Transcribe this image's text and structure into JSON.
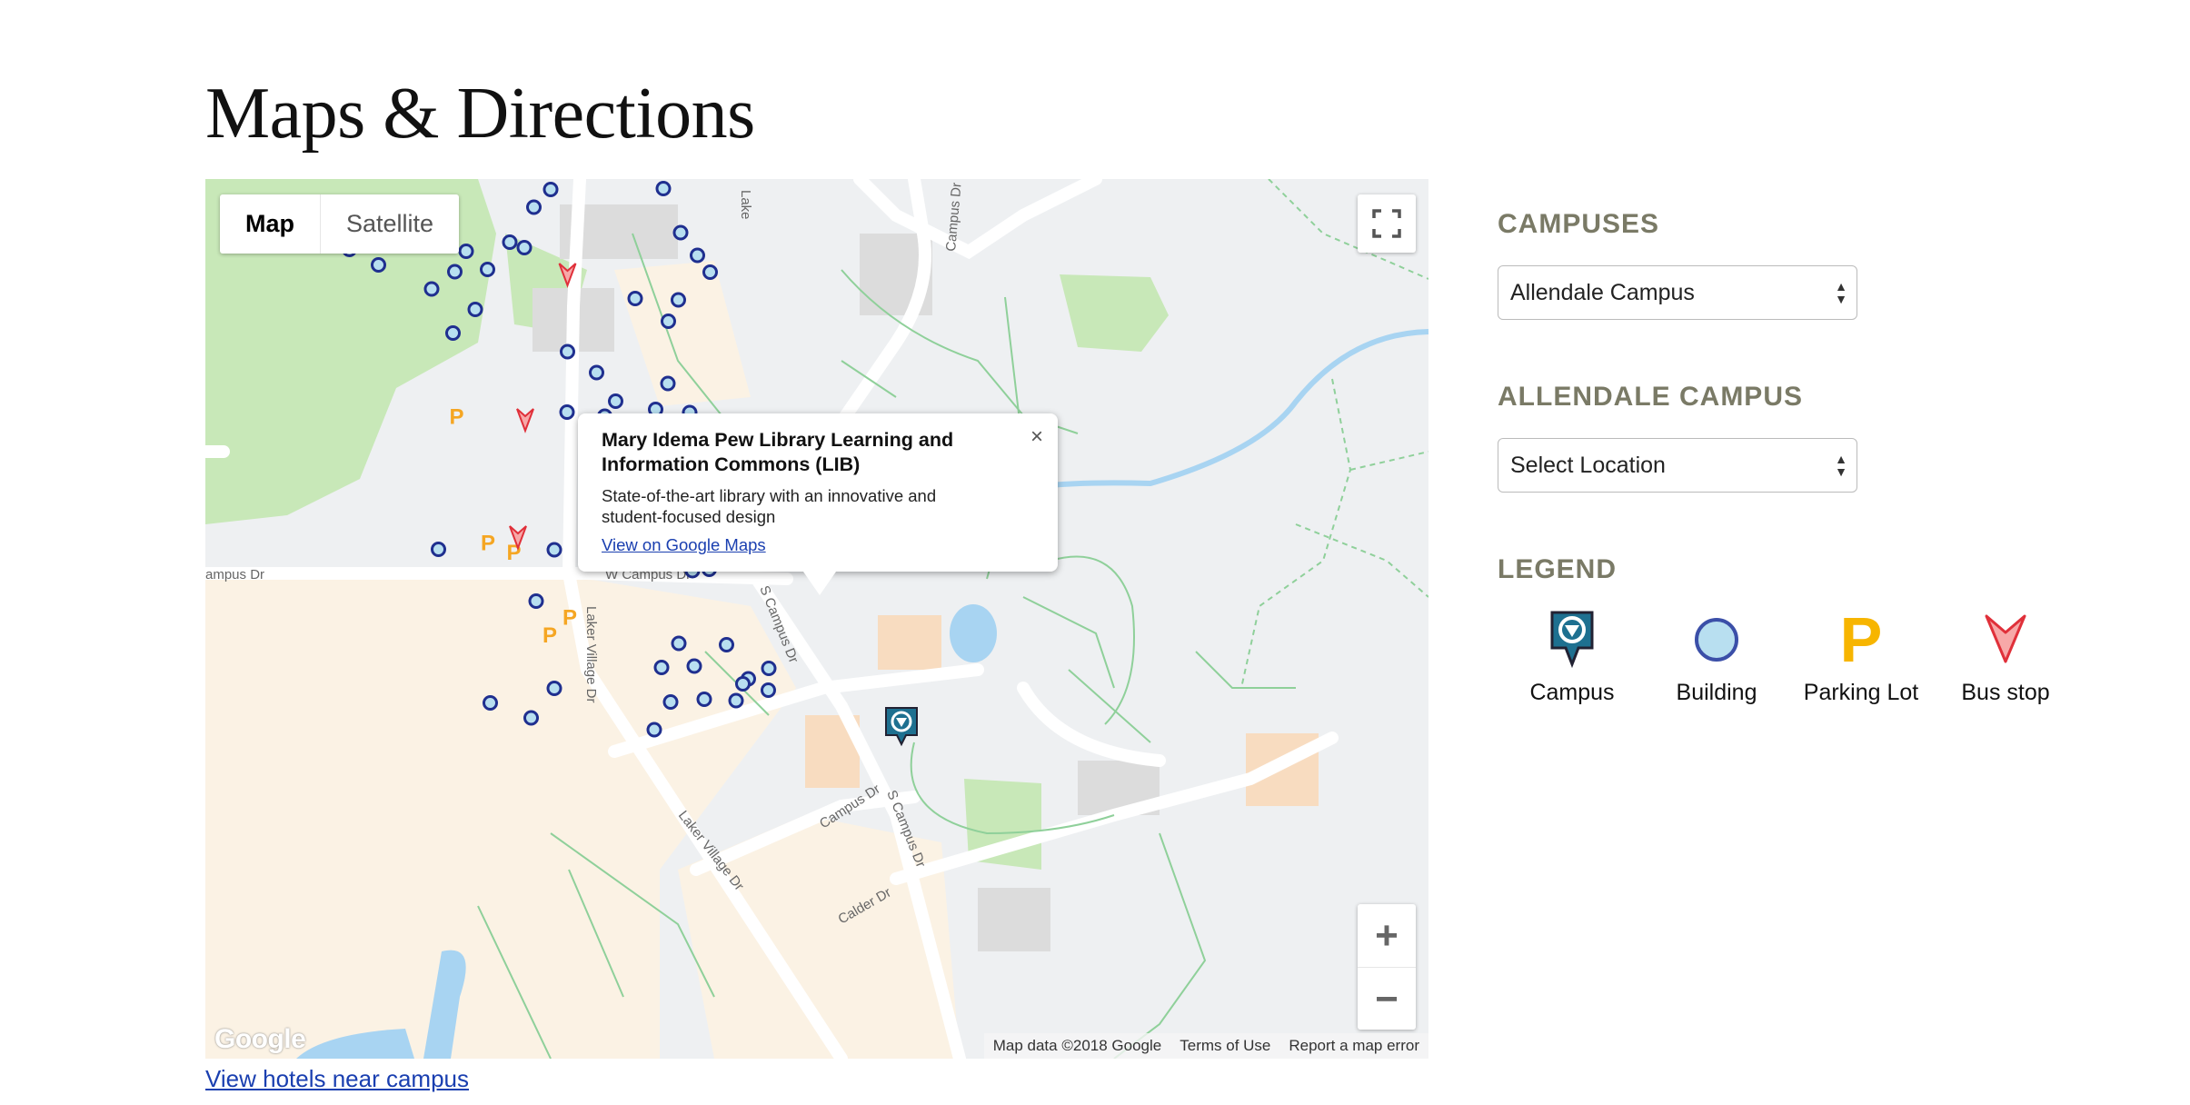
{
  "page": {
    "title": "Maps & Directions"
  },
  "map": {
    "type_controls": {
      "map": "Map",
      "satellite": "Satellite"
    },
    "popup": {
      "title": "Mary Idema Pew Library Learning and Information Commons (LIB)",
      "description": "State-of-the-art library with an innovative and student-focused design",
      "link": "View on Google Maps"
    },
    "street_labels": [
      "ampus Dr",
      "W Campus Dr",
      "Laker Village Dr",
      "S Campus Dr",
      "Campus Dr",
      "S Campus Dr",
      "Laker Village Dr",
      "Calder Dr",
      "Campus Dr",
      "Lake"
    ],
    "attribution": {
      "data": "Map data ©2018 Google",
      "terms": "Terms of Use",
      "report": "Report a map error"
    },
    "google_logo": "Google",
    "colors": {
      "building_marker": "#1f2f8f",
      "building_fill": "#b8dff0",
      "parking": "#f5a623",
      "bus_stop": "#e0303a",
      "park": "#c8e8b8",
      "water": "#a8d4f2"
    }
  },
  "links": {
    "hotels": "View hotels near campus"
  },
  "sidebar": {
    "campuses_heading": "CAMPUSES",
    "campus_select": "Allendale Campus",
    "location_heading": "ALLENDALE CAMPUS",
    "location_select": "Select Location",
    "legend_heading": "LEGEND",
    "legend": [
      {
        "label": "Campus",
        "icon": "campus-marker-icon"
      },
      {
        "label": "Building",
        "icon": "building-circle-icon"
      },
      {
        "label": "Parking Lot",
        "icon": "parking-p-icon"
      },
      {
        "label": "Bus stop",
        "icon": "bus-stop-arrow-icon"
      }
    ]
  }
}
